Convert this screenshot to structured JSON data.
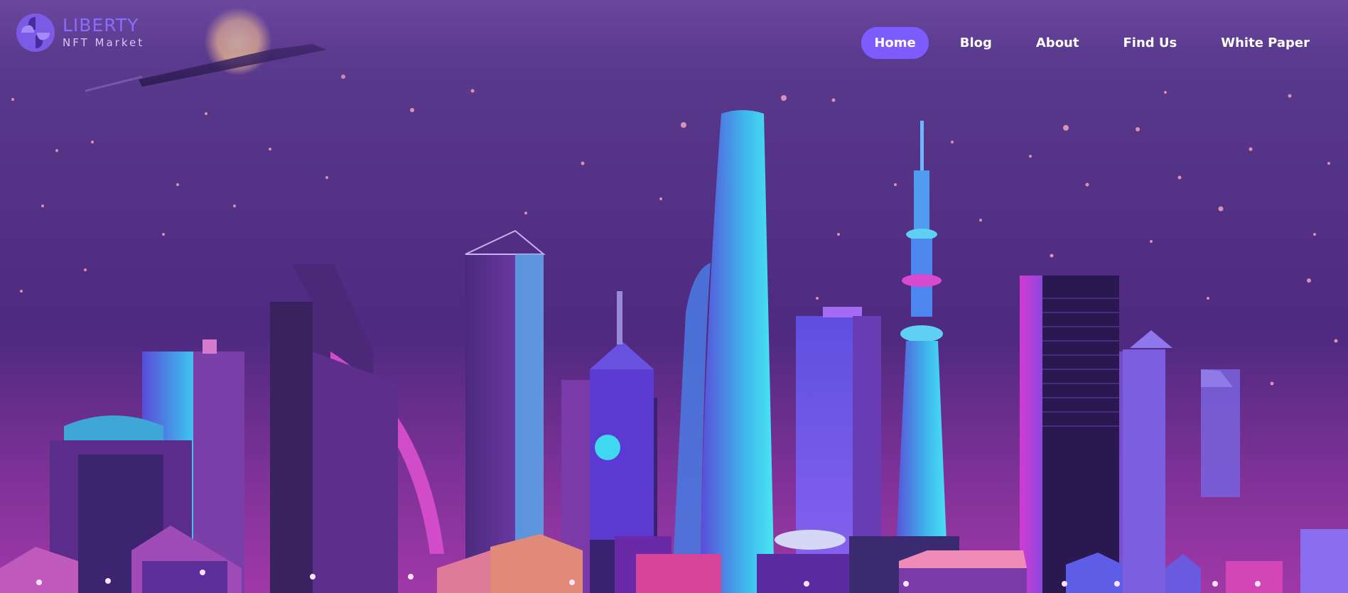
{
  "brand": {
    "title": "LIBERTY",
    "subtitle": "NFT Market"
  },
  "nav": {
    "items": [
      {
        "label": "Home",
        "active": true
      },
      {
        "label": "Blog",
        "active": false
      },
      {
        "label": "About",
        "active": false
      },
      {
        "label": "Find Us",
        "active": false
      },
      {
        "label": "White Paper",
        "active": false
      }
    ]
  },
  "theme": {
    "accent": "#7d5cff",
    "sky_top": "#5a3a8c",
    "sky_bottom": "#6a2f8a",
    "neon_cyan": "#3fd8f0",
    "neon_pink": "#e04ac8"
  },
  "hero": {
    "illustration": "neon-city-skyline-night"
  }
}
